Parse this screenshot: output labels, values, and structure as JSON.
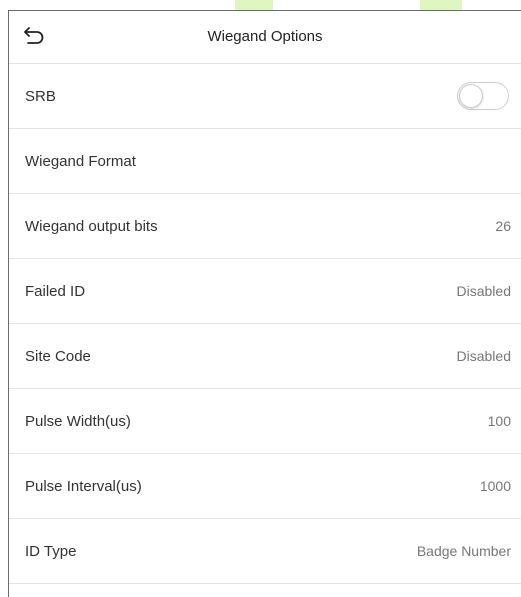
{
  "header": {
    "back_icon": "back-arrow-icon",
    "title": "Wiegand Options"
  },
  "settings": {
    "srb": {
      "label": "SRB",
      "toggle_on": false
    },
    "wiegand_format": {
      "label": "Wiegand Format",
      "value": ""
    },
    "wiegand_output_bits": {
      "label": "Wiegand output bits",
      "value": "26"
    },
    "failed_id": {
      "label": "Failed ID",
      "value": "Disabled"
    },
    "site_code": {
      "label": "Site Code",
      "value": "Disabled"
    },
    "pulse_width": {
      "label": "Pulse Width(us)",
      "value": "100"
    },
    "pulse_interval": {
      "label": "Pulse Interval(us)",
      "value": "1000"
    },
    "id_type": {
      "label": "ID Type",
      "value": "Badge Number"
    }
  },
  "colors": {
    "divider": "#e4e4e4",
    "label_text": "#333333",
    "value_text": "#777777",
    "toggle_off_border": "#cfcfcf"
  }
}
